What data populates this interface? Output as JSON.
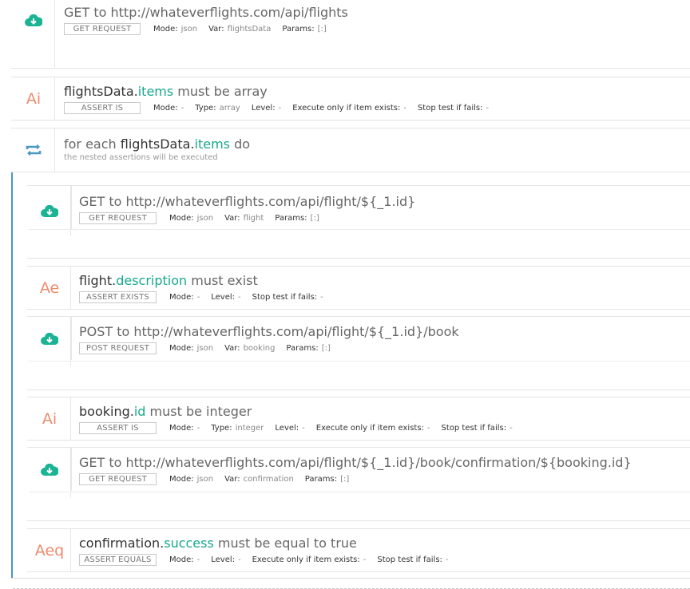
{
  "steps": [
    {
      "kind": "request",
      "icon": "cloud-download-icon",
      "method": "GET",
      "url": "http://whateverflights.com/api/flights",
      "tag": "GET REQUEST",
      "mode_label": "Mode:",
      "mode": "json",
      "var_label": "Var:",
      "var": "flightsData",
      "params_label": "Params:",
      "params": "[:]"
    },
    {
      "kind": "assert",
      "icon_text": "Ai",
      "subject": "flightsData",
      "dot": ".",
      "field": "items",
      "rest": " must be array",
      "tag": "ASSERT IS",
      "mode_label": "Mode:",
      "mode": "-",
      "type_label": "Type:",
      "type": "array",
      "level_label": "Level:",
      "level": "-",
      "exec_label": "Execute only if item exists:",
      "exec": "-",
      "stop_label": "Stop test if fails:",
      "stop": "-"
    },
    {
      "kind": "loop",
      "prefix": "for each ",
      "subject": "flightsData",
      "dot": ".",
      "field": "items",
      "suffix": " do",
      "subtitle": "the nested assertions will be executed"
    },
    {
      "kind": "request",
      "icon": "cloud-download-icon",
      "method": "GET",
      "url": "http://whateverflights.com/api/flight/${_1.id}",
      "tag": "GET REQUEST",
      "mode_label": "Mode:",
      "mode": "json",
      "var_label": "Var:",
      "var": "flight",
      "params_label": "Params:",
      "params": "[:]"
    },
    {
      "kind": "assert",
      "icon_text": "Ae",
      "subject": "flight",
      "dot": ".",
      "field": "description",
      "rest": " must exist",
      "tag": "ASSERT EXISTS",
      "mode_label": "Mode:",
      "mode": "-",
      "level_label": "Level:",
      "level": "-",
      "stop_label": "Stop test if fails:",
      "stop": "-"
    },
    {
      "kind": "request",
      "icon": "cloud-upload-icon",
      "method": "POST",
      "url": "http://whateverflights.com/api/flight/${_1.id}/book",
      "tag": "POST REQUEST",
      "mode_label": "Mode:",
      "mode": "json",
      "var_label": "Var:",
      "var": "booking",
      "params_label": "Params:",
      "params": "[:]"
    },
    {
      "kind": "assert",
      "icon_text": "Ai",
      "subject": "booking",
      "dot": ".",
      "field": "id",
      "rest": " must be integer",
      "tag": "ASSERT IS",
      "mode_label": "Mode:",
      "mode": "-",
      "type_label": "Type:",
      "type": "integer",
      "level_label": "Level:",
      "level": "-",
      "exec_label": "Execute only if item exists:",
      "exec": "-",
      "stop_label": "Stop test if fails:",
      "stop": "-"
    },
    {
      "kind": "request",
      "icon": "cloud-download-icon",
      "method": "GET",
      "url": "http://whateverflights.com/api/flight/${_1.id}/book/confirmation/${booking.id}",
      "tag": "GET REQUEST",
      "mode_label": "Mode:",
      "mode": "json",
      "var_label": "Var:",
      "var": "confirmation",
      "params_label": "Params:",
      "params": "[:]"
    },
    {
      "kind": "assert",
      "icon_text": "Aeq",
      "subject": "confirmation",
      "dot": ".",
      "field": "success",
      "rest": " must be equal to true",
      "tag": "ASSERT EQUALS",
      "mode_label": "Mode:",
      "mode": "-",
      "level_label": "Level:",
      "level": "-",
      "exec_label": "Execute only if item exists:",
      "exec": "-",
      "stop_label": "Stop test if fails:",
      "stop": "-"
    }
  ],
  "colors": {
    "request": "#1ab394",
    "assert": "#eb9a80",
    "loop": "#4a97c3",
    "accent": "#17a78c"
  }
}
